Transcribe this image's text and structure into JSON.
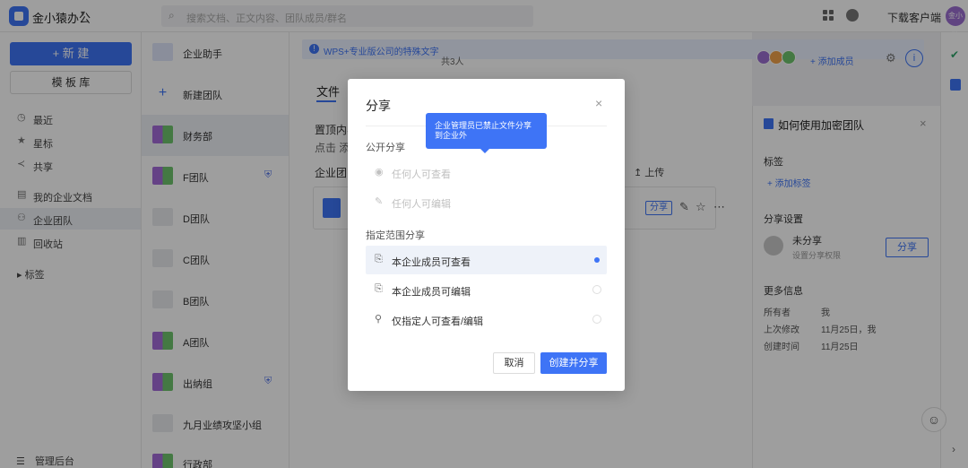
{
  "app": {
    "name": "金小猿办公"
  },
  "search": {
    "placeholder": "搜索文档、正文内容、团队成员/群名"
  },
  "topbar": {
    "download_label": "下载客户端",
    "avatar_text": "金小猿"
  },
  "leftnav": {
    "new_label": "+ 新 建",
    "template_label": "模 板 库",
    "items": [
      {
        "icon": "clock-icon",
        "label": "最近"
      },
      {
        "icon": "star-icon",
        "label": "星标"
      },
      {
        "icon": "share-icon",
        "label": "共享"
      },
      {
        "icon": "document-icon",
        "label": "我的企业文档"
      },
      {
        "icon": "team-icon",
        "label": "企业团队"
      },
      {
        "icon": "trash-icon",
        "label": "回收站"
      },
      {
        "icon": "tag-icon",
        "label": "▸ 标签"
      }
    ],
    "admin_label": "管理后台"
  },
  "teams": [
    {
      "name": "企业助手"
    },
    {
      "name": "新建团队"
    },
    {
      "name": "财务部"
    },
    {
      "name": "F团队"
    },
    {
      "name": "D团队"
    },
    {
      "name": "C团队"
    },
    {
      "name": "B团队"
    },
    {
      "name": "A团队"
    },
    {
      "name": "出纳组"
    },
    {
      "name": "九月业绩攻坚小组"
    },
    {
      "name": "行政部"
    }
  ],
  "main": {
    "notice": "WPS+专业版公司的特殊文字",
    "files_tab": "文件",
    "pinned_title": "置顶内容",
    "pinned_sub": "点击 添加",
    "section_title": "企业团队",
    "upload_label": "↥ 上传",
    "share_chip": "分享",
    "member_count": "共3人",
    "add_member": "+ 添加成员"
  },
  "rightpanel": {
    "title": "如何使用加密团队",
    "tags_label": "标签",
    "add_tag": "+ 添加标签",
    "share_settings": "分享设置",
    "not_shared": "未分享",
    "set_permission": "设置分享权限",
    "share_button": "分享",
    "more_info": "更多信息",
    "owner_k": "所有者",
    "owner_v": "我",
    "modified_k": "上次修改",
    "modified_v": "11月25日，我",
    "created_k": "创建时间",
    "created_v": "11月25日"
  },
  "dialog": {
    "title": "分享",
    "public_section": "公开分享",
    "public_options": [
      {
        "label": "任何人可查看"
      },
      {
        "label": "任何人可编辑"
      }
    ],
    "scoped_section": "指定范围分享",
    "scoped_options": [
      {
        "label": "本企业成员可查看",
        "selected": true
      },
      {
        "label": "本企业成员可编辑",
        "selected": false
      },
      {
        "label": "仅指定人可查看/编辑",
        "selected": false
      }
    ],
    "cancel_label": "取消",
    "create_label": "创建并分享",
    "tooltip": "企业管理员已禁止文件分享到企业外"
  },
  "colors": {
    "accent": "#3e74f6",
    "overlay": "rgba(0,0,0,0.38)"
  }
}
